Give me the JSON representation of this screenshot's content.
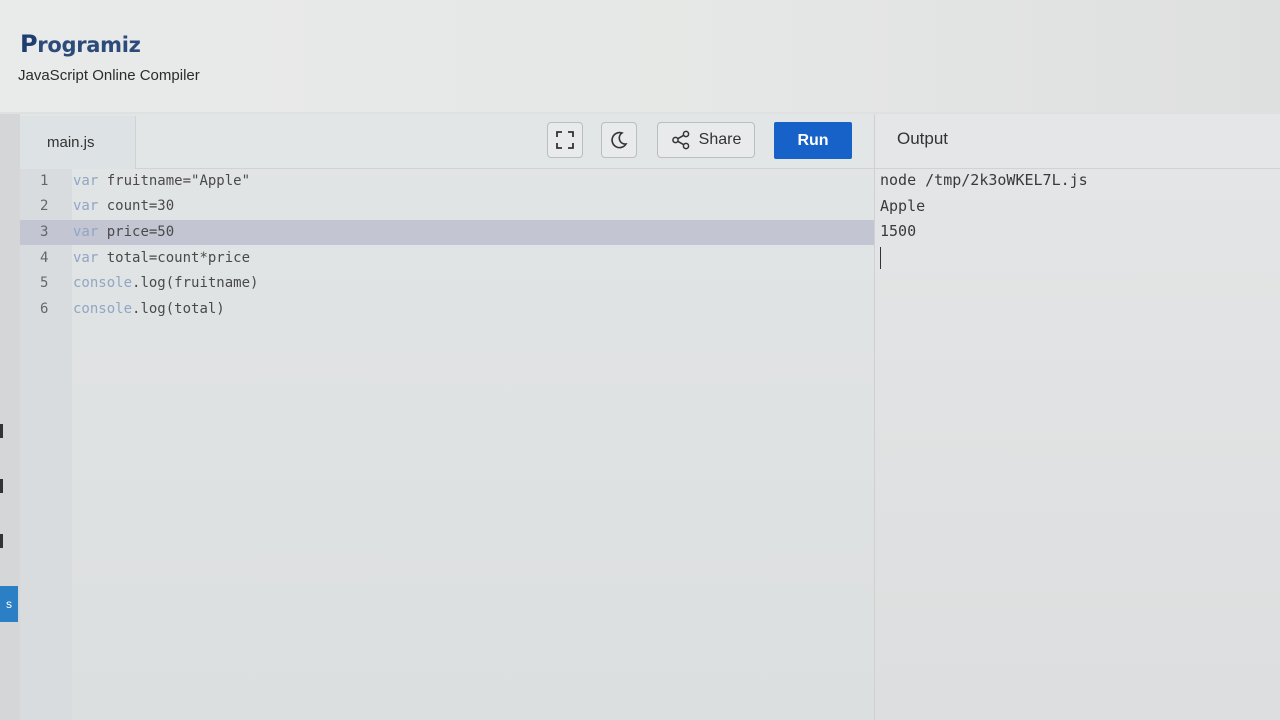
{
  "brand": {
    "logo_p": "P",
    "logo_rest": "rogramiz",
    "subtitle": "JavaScript Online Compiler"
  },
  "editor": {
    "tab_label": "main.js",
    "fullscreen_icon": "fullscreen-icon",
    "theme_icon": "moon-icon",
    "share_icon": "share-icon",
    "share_label": "Share",
    "run_label": "Run",
    "active_line": 3,
    "lines": [
      {
        "num": "1",
        "kw": "var",
        "rest": " fruitname=\"Apple\""
      },
      {
        "num": "2",
        "kw": "var",
        "rest": " count=30"
      },
      {
        "num": "3",
        "kw": "var",
        "rest": " price=50"
      },
      {
        "num": "4",
        "kw": "var",
        "rest": " total=count*price"
      },
      {
        "num": "5",
        "kw": "console",
        "rest": ".log(fruitname)"
      },
      {
        "num": "6",
        "kw": "console",
        "rest": ".log(total)"
      }
    ]
  },
  "output": {
    "title": "Output",
    "lines": [
      "node /tmp/2k3oWKEL7L.js",
      "Apple",
      "1500"
    ]
  },
  "colors": {
    "run_button": "#1662c9",
    "active_line": "#c3c6d2",
    "keyword": "#8fa6c4",
    "logo": "#1e3e72"
  }
}
